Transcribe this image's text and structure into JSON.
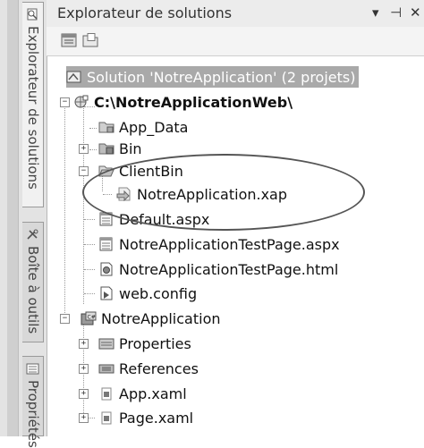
{
  "panel": {
    "title": "Explorateur de solutions",
    "controls": {
      "dropdown": "▾",
      "pin": "⊣",
      "close": "✕"
    }
  },
  "side_tabs": [
    {
      "label": "Explorateur de solutions",
      "icon": "solution-explorer-icon"
    },
    {
      "label": "Boîte à outils",
      "icon": "toolbox-icon"
    },
    {
      "label": "Propriétés",
      "icon": "properties-icon"
    }
  ],
  "toolbar": [
    {
      "icon": "properties-icon"
    },
    {
      "icon": "show-all-files-icon"
    }
  ],
  "tree": {
    "solution": "Solution 'NotreApplication' (2 projets)",
    "website": "C:\\NotreApplicationWeb\\",
    "app_data": "App_Data",
    "bin": "Bin",
    "clientbin": "ClientBin",
    "xap": "NotreApplication.xap",
    "default_aspx": "Default.aspx",
    "testpage_aspx": "NotreApplicationTestPage.aspx",
    "testpage_html": "NotreApplicationTestPage.html",
    "web_config": "web.config",
    "project": "NotreApplication",
    "properties": "Properties",
    "references": "References",
    "app_xaml": "App.xaml",
    "page_xaml": "Page.xaml"
  },
  "colors": {
    "selection": "#a9a9a9",
    "annotation": "#555555"
  }
}
